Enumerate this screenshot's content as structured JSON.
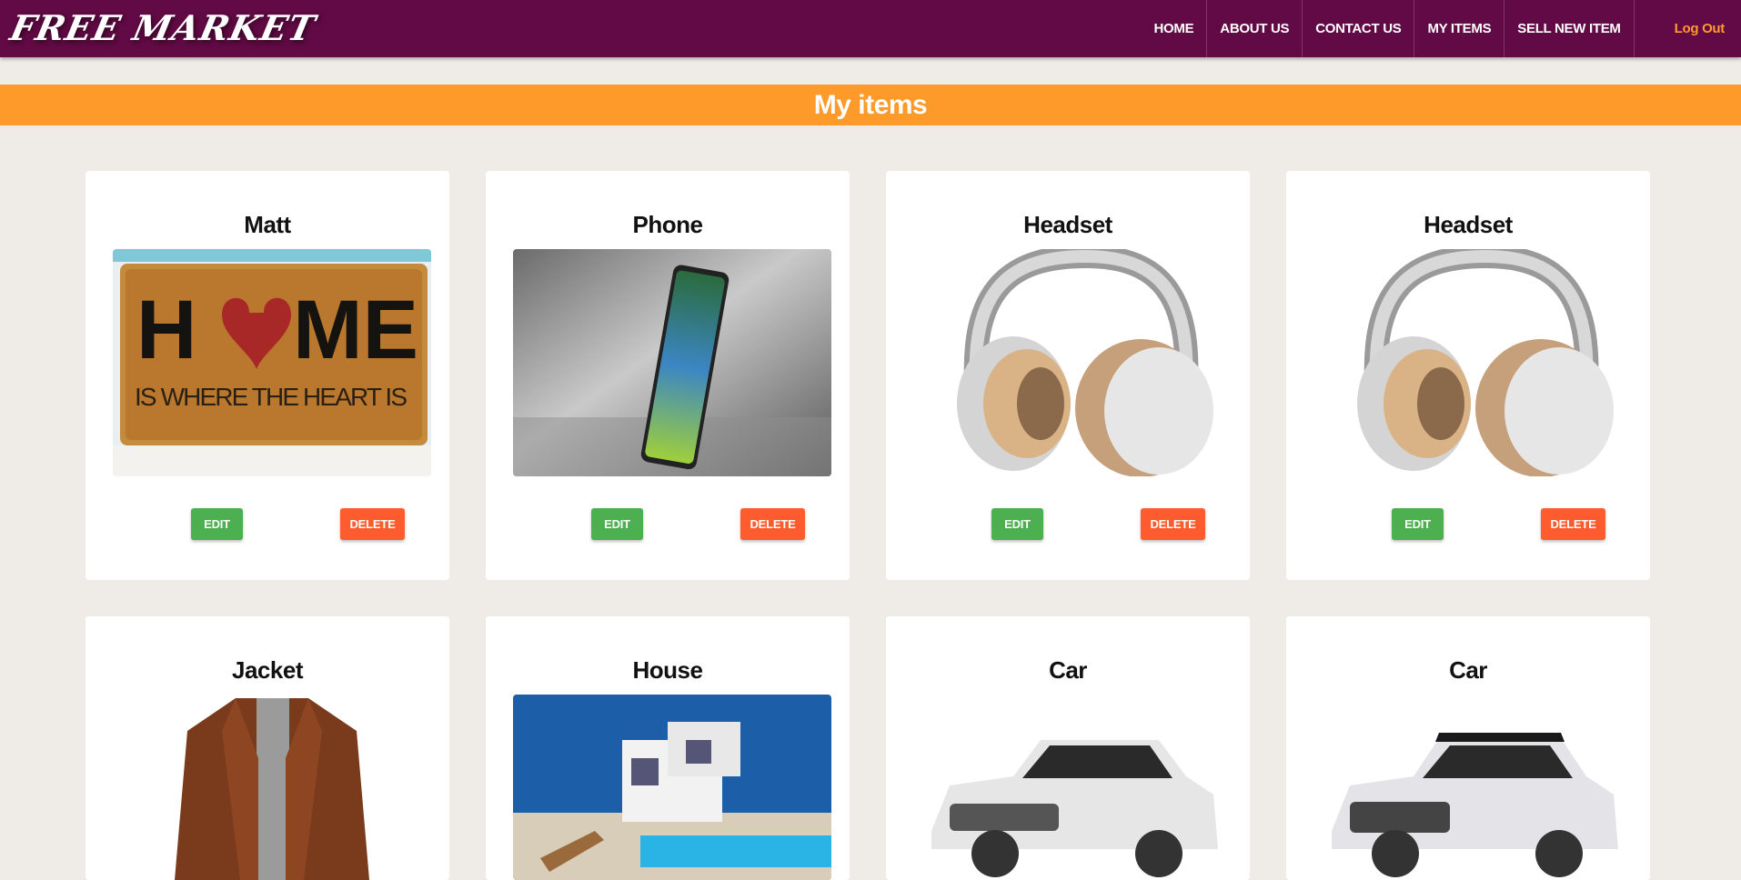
{
  "brand": {
    "logo_text": "FREE MARKET",
    "primary_color": "#620a45",
    "accent_color": "#fd9a2a"
  },
  "nav": {
    "links": [
      "HOME",
      "ABOUT US",
      "CONTACT US",
      "MY ITEMS",
      "SELL NEW ITEM"
    ],
    "logout": "Log Out"
  },
  "page": {
    "title": "My items"
  },
  "items": [
    {
      "name": "Matt",
      "image": "doormat-home-is-where-the-heart-is"
    },
    {
      "name": "Phone",
      "image": "smartphone"
    },
    {
      "name": "Headset",
      "image": "over-ear-headphones"
    },
    {
      "name": "Headset",
      "image": "over-ear-headphones"
    },
    {
      "name": "Jacket",
      "image": "brown-leather-jacket"
    },
    {
      "name": "House",
      "image": "villa-with-pool"
    },
    {
      "name": "Car",
      "image": "white-suv"
    },
    {
      "name": "Car",
      "image": "white-suv-black-roof"
    }
  ],
  "buttons": {
    "edit": "EDIT",
    "delete": "DELETE"
  },
  "doormat": {
    "line1_left": "H",
    "line1_right": "ME",
    "line2": "IS WHERE THE HEART IS"
  }
}
